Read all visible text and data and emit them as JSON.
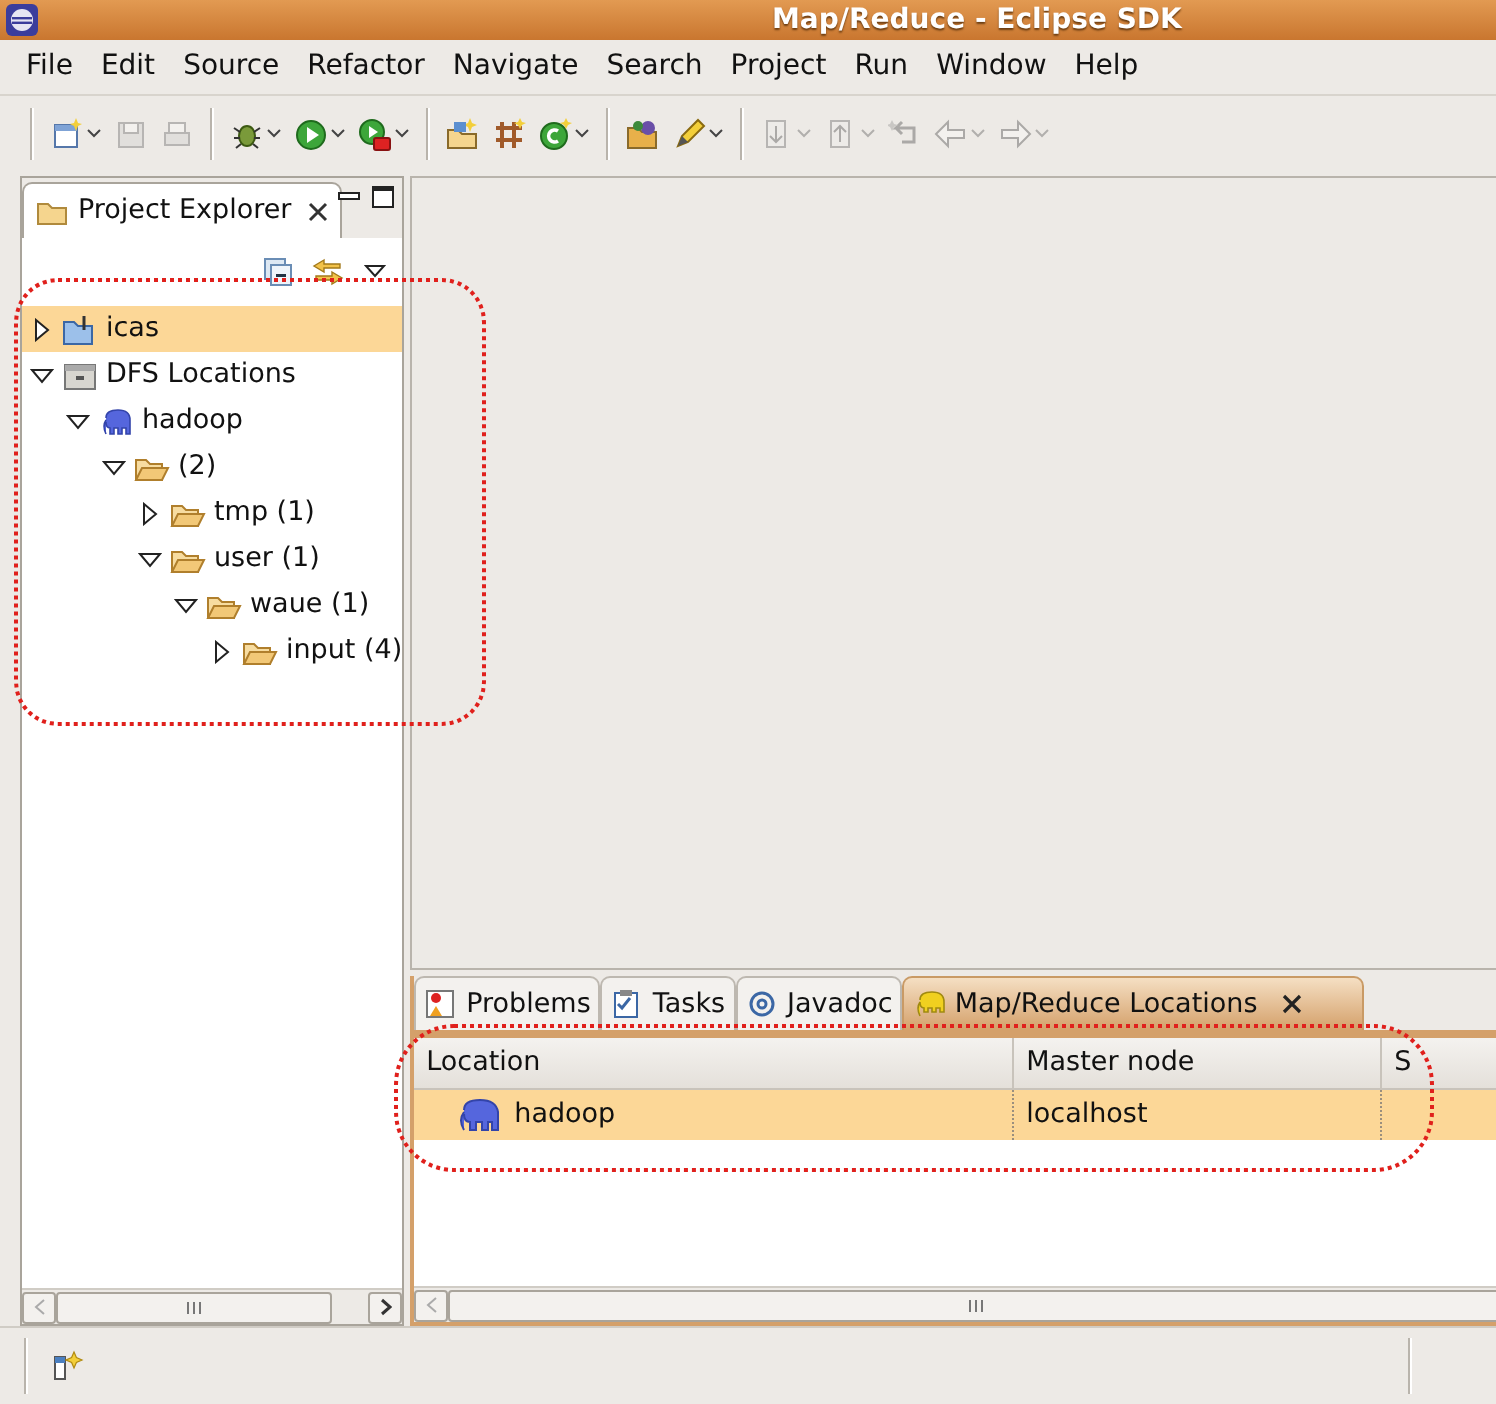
{
  "window": {
    "title": "Map/Reduce - Eclipse SDK"
  },
  "menu": [
    "File",
    "Edit",
    "Source",
    "Refactor",
    "Navigate",
    "Search",
    "Project",
    "Run",
    "Window",
    "Help"
  ],
  "toolbar": [
    {
      "items": [
        {
          "kind": "new",
          "disabled": false,
          "dropdown": true
        },
        {
          "kind": "save",
          "disabled": true,
          "dropdown": false
        },
        {
          "kind": "print",
          "disabled": true,
          "dropdown": false
        }
      ]
    },
    {
      "items": [
        {
          "kind": "debug",
          "disabled": false,
          "dropdown": true
        },
        {
          "kind": "run",
          "disabled": false,
          "dropdown": true
        },
        {
          "kind": "external",
          "disabled": false,
          "dropdown": true
        }
      ]
    },
    {
      "items": [
        {
          "kind": "package",
          "disabled": false,
          "dropdown": false
        },
        {
          "kind": "class",
          "disabled": false,
          "dropdown": false
        },
        {
          "kind": "newclass",
          "disabled": false,
          "dropdown": true
        }
      ]
    },
    {
      "items": [
        {
          "kind": "open",
          "disabled": false,
          "dropdown": false
        },
        {
          "kind": "pen",
          "disabled": false,
          "dropdown": true
        }
      ]
    },
    {
      "items": [
        {
          "kind": "down",
          "disabled": true,
          "dropdown": true
        },
        {
          "kind": "up",
          "disabled": true,
          "dropdown": true
        },
        {
          "kind": "lastedit",
          "disabled": true,
          "dropdown": false
        },
        {
          "kind": "back",
          "disabled": true,
          "dropdown": true
        },
        {
          "kind": "forward",
          "disabled": true,
          "dropdown": true
        }
      ]
    }
  ],
  "explorer": {
    "title": "Project Explorer",
    "outlined": true,
    "tree": [
      {
        "label": "icas",
        "kind": "project",
        "expanded": false,
        "selected": true
      },
      {
        "label": "DFS Locations",
        "kind": "dfs",
        "expanded": true,
        "selected": false,
        "children": [
          {
            "label": "hadoop",
            "kind": "server",
            "expanded": true,
            "selected": false,
            "children": [
              {
                "label": "(2)",
                "kind": "folder",
                "expanded": true,
                "selected": false,
                "children": [
                  {
                    "label": "tmp (1)",
                    "kind": "folder",
                    "expanded": false,
                    "selected": false
                  },
                  {
                    "label": "user (1)",
                    "kind": "folder",
                    "expanded": true,
                    "selected": false,
                    "children": [
                      {
                        "label": "waue (1)",
                        "kind": "folder",
                        "expanded": true,
                        "selected": false,
                        "children": [
                          {
                            "label": "input (4)",
                            "kind": "folder",
                            "expanded": false,
                            "selected": false
                          }
                        ]
                      }
                    ]
                  }
                ]
              }
            ]
          }
        ]
      }
    ]
  },
  "bottom_view": {
    "outlined": true,
    "tabs": [
      {
        "label": "Problems",
        "kind": "problems",
        "selected": false
      },
      {
        "label": "Tasks",
        "kind": "tasks",
        "selected": false
      },
      {
        "label": "Javadoc",
        "kind": "javadoc",
        "selected": false
      },
      {
        "label": "Map/Reduce Locations",
        "kind": "mapreduce",
        "selected": true
      }
    ],
    "columns": [
      "Location",
      "Master node",
      "S"
    ],
    "rows": [
      {
        "cells": [
          "hadoop",
          "localhost"
        ],
        "selected": true
      }
    ]
  }
}
